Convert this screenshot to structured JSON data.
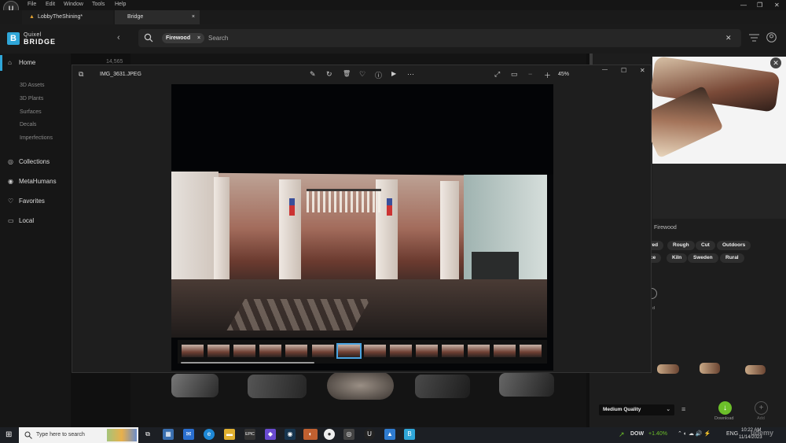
{
  "menubar": {
    "logo": "U",
    "items": [
      "File",
      "Edit",
      "Window",
      "Tools",
      "Help"
    ],
    "controls": {
      "minimize": "—",
      "maximize": "❐",
      "close": "✕"
    }
  },
  "tabs": [
    {
      "label": "LobbyTheShining*",
      "active": false
    },
    {
      "label": "Bridge",
      "active": true,
      "close": "×"
    }
  ],
  "bridge": {
    "logo_letter": "B",
    "brand_top": "Quixel",
    "brand_bottom": "BRIDGE",
    "collapse_icon": "‹",
    "search": {
      "chip": "Firewood",
      "chip_close": "×",
      "placeholder": "Search",
      "clear": "✕"
    },
    "sidebar": {
      "home": "Home",
      "home_count": "14,565",
      "sub_items": [
        "3D Assets",
        "3D Plants",
        "Surfaces",
        "Decals",
        "Imperfections"
      ],
      "items": [
        "Collections",
        "MetaHumans",
        "Favorites",
        "Local"
      ]
    },
    "right_panel": {
      "close": "✕",
      "tag_title": "Firewood",
      "tags_row1": [
        "red",
        "Rough",
        "Cut",
        "Outdoors"
      ],
      "tags_row2": [
        "ce",
        "Kiln",
        "Sweden",
        "Rural"
      ],
      "partial_label": "d",
      "quality": "Medium Quality",
      "quality_dd": "⌄",
      "download_label": "Download",
      "add_label": "Add",
      "download_icon": "↓",
      "add_icon": "+",
      "settings_icon": "≡"
    }
  },
  "viewer": {
    "filename": "IMG_3631.JPEG",
    "zoom": "45%",
    "toolbar_icons": [
      "edit-icon",
      "rotate-icon",
      "delete-icon",
      "favorite-icon",
      "info-icon",
      "slideshow-icon",
      "more-icon"
    ],
    "toolbar_glyphs": [
      "✎",
      "↻",
      "🗑",
      "♡",
      "ⓘ",
      "▶",
      "⋯"
    ],
    "right_glyphs": {
      "expand": "⤢",
      "fit": "▭",
      "zoom_out": "−",
      "zoom_in": "＋"
    },
    "window": {
      "minimize": "—",
      "maximize": "☐",
      "close": "✕"
    },
    "thumb_count": 14,
    "selected_thumb": 6
  },
  "taskbar": {
    "search_placeholder": "Type here to search",
    "stock": {
      "name": "DOW",
      "change": "+1.40%"
    },
    "lang": "ENG",
    "time": "10:22 AM",
    "date": "11/14/2023",
    "watermark": "udemy"
  },
  "colors": {
    "accent": "#2fa6d8",
    "download": "#6cbf2a",
    "selection": "#4aa3e0"
  }
}
